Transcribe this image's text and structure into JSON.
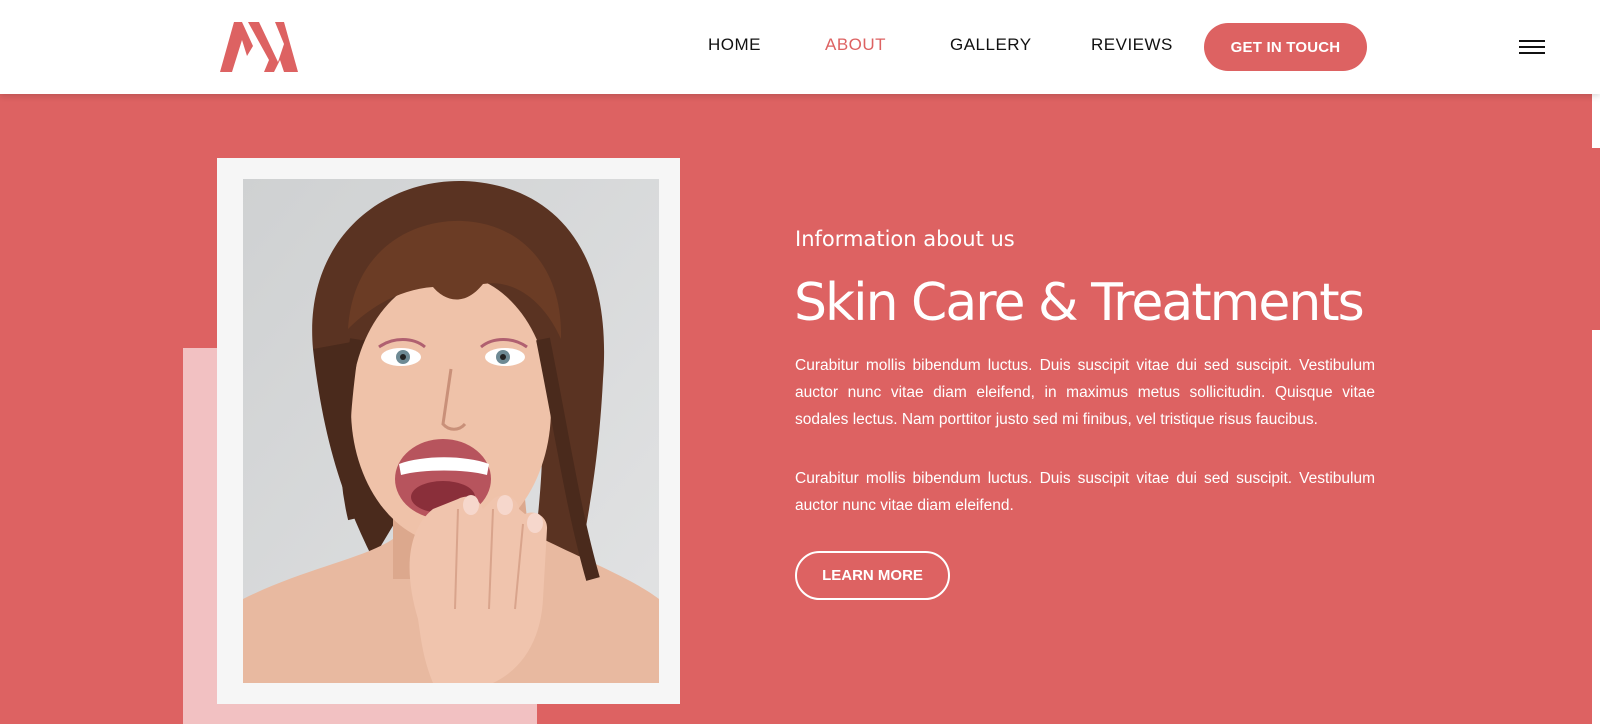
{
  "colors": {
    "accent": "#dd6262",
    "accent_light": "#f2c1c2",
    "frame": "#f6f6f6",
    "text_dark": "#111111",
    "text_light": "#ffffff"
  },
  "header": {
    "logo_icon": "m-logo-icon",
    "nav": [
      {
        "label": "HOME",
        "active": false
      },
      {
        "label": "ABOUT",
        "active": true
      },
      {
        "label": "GALLERY",
        "active": false
      },
      {
        "label": "REVIEWS",
        "active": false
      }
    ],
    "cta_label": "GET IN TOUCH",
    "menu_icon": "hamburger-menu-icon"
  },
  "about": {
    "eyebrow": "Information about us",
    "heading": "Skin Care & Treatments",
    "paragraphs": [
      "Curabitur mollis bibendum luctus. Duis suscipit vitae dui sed suscipit. Vestibulum auctor nunc vitae diam eleifend, in maximus metus sollicitudin. Quisque vitae sodales lectus. Nam porttitor justo sed mi finibus, vel tristique risus faucibus.",
      "Curabitur mollis bibendum luctus. Duis suscipit vitae dui sed suscipit. Vestibulum auctor nunc vitae diam eleifend."
    ],
    "button_label": "LEARN MORE"
  }
}
